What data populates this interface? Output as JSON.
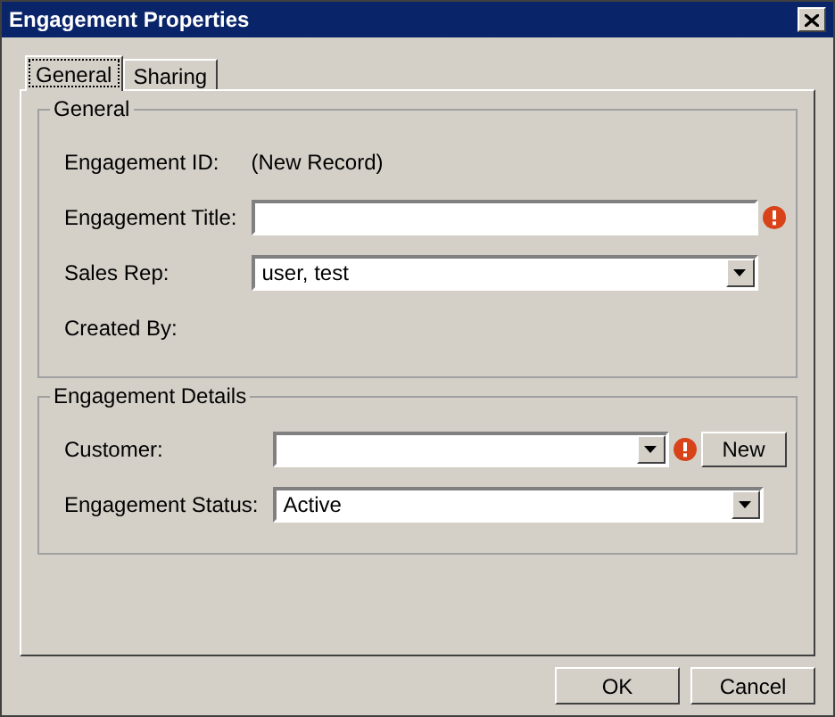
{
  "window": {
    "title": "Engagement Properties"
  },
  "tabs": [
    {
      "label": "General",
      "selected": true
    },
    {
      "label": "Sharing",
      "selected": false
    }
  ],
  "groups": [
    {
      "title": "General",
      "rows": [
        {
          "label": "Engagement ID:",
          "kind": "static",
          "value": "(New Record)"
        },
        {
          "label": "Engagement Title:",
          "kind": "text",
          "value": "",
          "required": true
        },
        {
          "label": "Sales Rep:",
          "kind": "dropdown",
          "value": "user, test",
          "required": false
        },
        {
          "label": "Created By:",
          "kind": "static",
          "value": ""
        }
      ]
    },
    {
      "title": "Engagement Details",
      "rows": [
        {
          "label": "Customer:",
          "kind": "dropdown",
          "value": "",
          "required": true,
          "button": "New"
        },
        {
          "label": "Engagement Status:",
          "kind": "dropdown",
          "value": "Active",
          "required": false
        }
      ]
    }
  ],
  "buttons": [
    "OK",
    "Cancel"
  ]
}
